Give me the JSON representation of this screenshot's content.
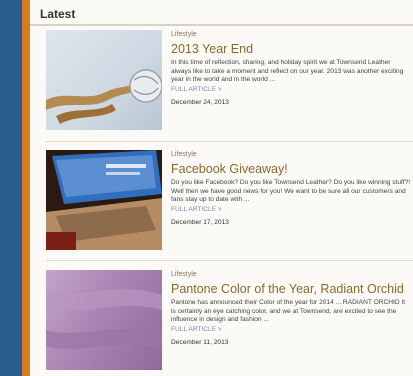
{
  "section": {
    "title": "Latest"
  },
  "articles": [
    {
      "category": "Lifestyle",
      "title": "2013 Year End",
      "excerpt": "In this time of reflection, sharing, and holiday spirit we at Townsend Leather always like to take a moment and reflect on our year.  2013 was another exciting year in the world and in the world ...",
      "more": "FULL ARTICLE >",
      "date": "December 24, 2013"
    },
    {
      "category": "Lifestyle",
      "title": "Facebook Giveaway!",
      "excerpt": "Do you like Facebook? Do you like Townsend Leather?  Do you like winning stuff?! Well then we have good news for you! We want to be sure all our customers and fans stay up to date with ...",
      "more": "FULL ARTICLE >",
      "date": "December 17, 2013"
    },
    {
      "category": "Lifestyle",
      "title": "Pantone Color of the Year, Radiant Orchid",
      "excerpt": "  Pantone has announced their Color of the year for 2014 ... RADIANT ORCHID It is certainly an eye catching color, and we at Townsend, are excited to see the influence in design and fashion ...",
      "more": "FULL ARTICLE >",
      "date": "December 11, 2013"
    }
  ]
}
